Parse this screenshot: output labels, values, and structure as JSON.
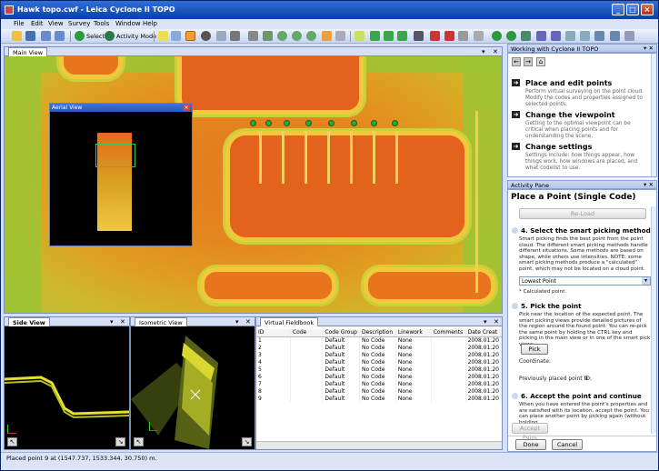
{
  "window": {
    "title": "Hawk topo.cwf - Leica Cyclone II TOPO"
  },
  "menu": [
    "File",
    "Edit",
    "View",
    "Survey",
    "Tools",
    "Window",
    "Help"
  ],
  "toolbar": {
    "select_label": "Select",
    "activity_label": "Activity Mode"
  },
  "main_view": {
    "tab": "Main View"
  },
  "aerial_view": {
    "title": "Aerial View"
  },
  "side_view": {
    "tab": "Side View"
  },
  "isometric_view": {
    "tab": "Isometric View"
  },
  "fieldbook": {
    "tab": "Virtual Fieldbook",
    "columns": [
      "ID",
      "Code",
      "Code Group",
      "Description",
      "Linework",
      "Comments",
      "Date Creat"
    ],
    "rows": [
      [
        "1",
        "",
        "Default",
        "No Code",
        "None",
        "",
        "2008.01.20"
      ],
      [
        "2",
        "",
        "Default",
        "No Code",
        "None",
        "",
        "2008.01.20"
      ],
      [
        "3",
        "",
        "Default",
        "No Code",
        "None",
        "",
        "2008.01.20"
      ],
      [
        "4",
        "",
        "Default",
        "No Code",
        "None",
        "",
        "2008.01.20"
      ],
      [
        "5",
        "",
        "Default",
        "No Code",
        "None",
        "",
        "2008.01.20"
      ],
      [
        "6",
        "",
        "Default",
        "No Code",
        "None",
        "",
        "2008.01.20"
      ],
      [
        "7",
        "",
        "Default",
        "No Code",
        "None",
        "",
        "2008.01.20"
      ],
      [
        "8",
        "",
        "Default",
        "No Code",
        "None",
        "",
        "2008.01.20"
      ],
      [
        "9",
        "",
        "Default",
        "No Code",
        "None",
        "",
        "2008.01.20"
      ]
    ]
  },
  "working_panel": {
    "title": "Working with Cyclone II TOPO",
    "items": [
      {
        "title": "Place and edit points",
        "desc": "Perform virtual surveying on the point cloud. Modify the codes and properties assigned to selected points."
      },
      {
        "title": "Change the viewpoint",
        "desc": "Getting to the optimal viewpoint can be critical when placing points and for understanding the scene."
      },
      {
        "title": "Change settings",
        "desc": "Settings include: how things appear, how things work, how windows are placed, and what codelist to use."
      }
    ]
  },
  "activity_pane": {
    "header": "Activity Pane",
    "title": "Place a Point (Single Code)",
    "reload_label": "Re-Load",
    "step4_title": "4. Select the smart picking method",
    "step4_text": "Smart picking finds the best point from the point cloud. The different smart picking methods handle different situations. Some methods are based on shape, while others use intensities. NOTE: some smart picking methods produce a \"calculated\" point, which may not be located on a cloud point.",
    "method_value": "Lowest Point",
    "calc_note": "* Calculated point.",
    "step5_title": "5. Pick the point",
    "step5_text": "Pick near the location of the expected point. The smart picking views provide detailed pictures of the region around the found point. You can re-pick the same point by holding the CTRL key and picking in the main view or in one of the smart pick views.",
    "pick_label": "Pick",
    "coordinate_label": "Coordinate:",
    "prev_label": "Previously placed point ID:",
    "prev_value": "9",
    "step6_title": "6. Accept the point and continue",
    "step6_text": "When you have entered the point's properties and are satisfied with its location, accept the point. You can place another point by picking again (without holding",
    "accept_label": "Accept Point",
    "done_label": "Done",
    "cancel_label": "Cancel"
  },
  "status": {
    "text": "Placed point 9 at (1547.737, 1533.344, 30.750) m."
  }
}
